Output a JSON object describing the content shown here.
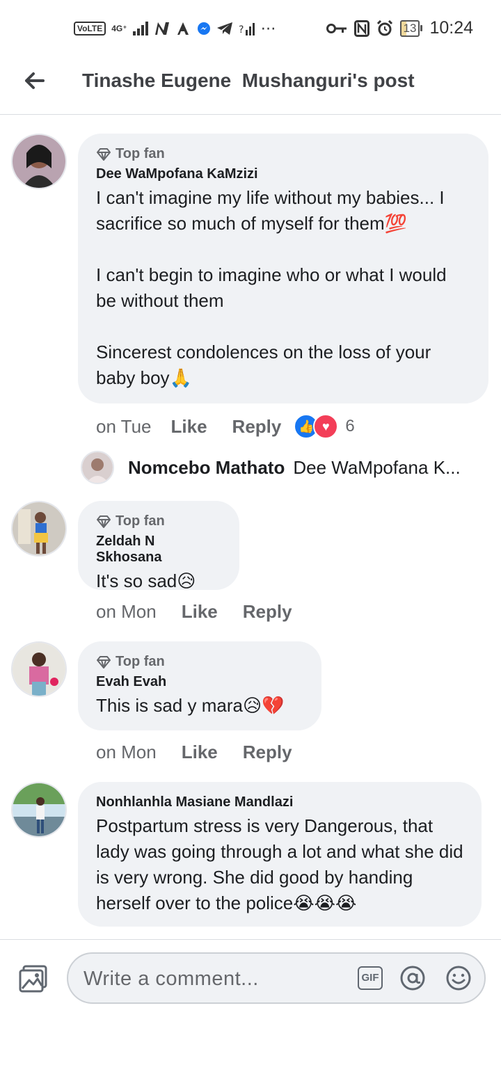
{
  "status_bar": {
    "volte": "VoLTE",
    "network": "4G⁺",
    "time": "10:24",
    "battery": "13"
  },
  "header": {
    "title": "Tinashe Eugene  Mushanguri's post"
  },
  "comments": [
    {
      "badge": "Top fan",
      "author": "Dee WaMpofana KaMzizi",
      "text": "I can't imagine my life without my babies... I sacrifice so much of myself for them💯\n\nI can't begin to imagine who or what I would be without them\n\nSincerest condolences on the loss of your baby boy🙏",
      "time": "on Tue",
      "like": "Like",
      "reply": "Reply",
      "reactions_count": "6",
      "reply_preview": {
        "name": "Nomcebo Mathato",
        "text": "Dee WaMpofana K..."
      }
    },
    {
      "badge": "Top fan",
      "author": "Zeldah N Skhosana",
      "text": "It's so sad😥",
      "time": "on Mon",
      "like": "Like",
      "reply": "Reply"
    },
    {
      "badge": "Top fan",
      "author": "Evah Evah",
      "text": "This is sad y mara😥💔",
      "time": "on Mon",
      "like": "Like",
      "reply": "Reply"
    },
    {
      "author": "Nonhlanhla Masiane Mandlazi",
      "text": "Postpartum stress is very Dangerous, that lady was going through a lot and what she did is very wrong. She did good by handing herself over to the police😭😭😭"
    }
  ],
  "composer": {
    "placeholder": "Write a comment...",
    "gif_label": "GIF"
  },
  "colors": {
    "bubble": "#f0f2f5",
    "like_blue": "#1877f2",
    "love_red": "#f33e58",
    "secondary_text": "#65676b"
  }
}
